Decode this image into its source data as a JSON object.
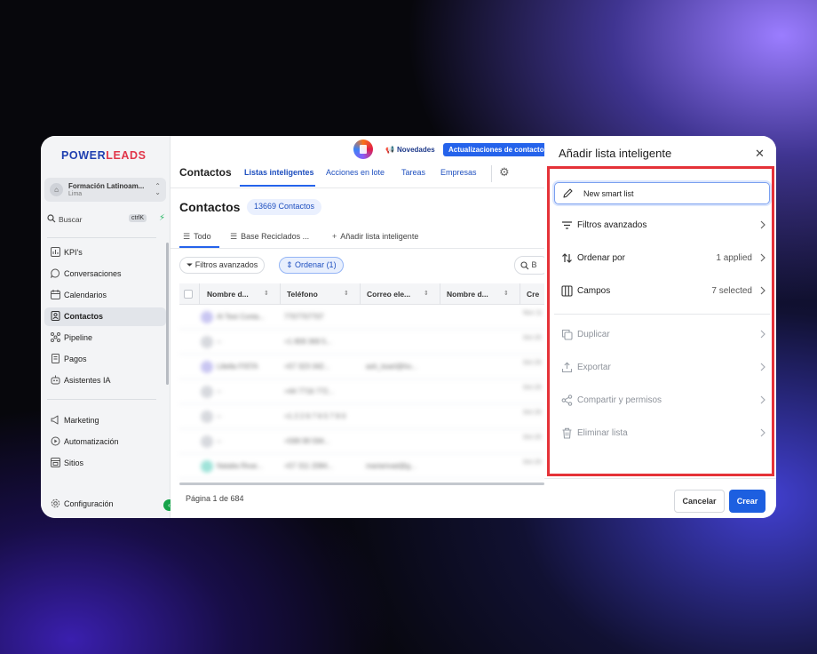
{
  "sidebar": {
    "logo": "POWERLEADS",
    "account": {
      "name": "Formación Latinoam...",
      "location": "Lima"
    },
    "search": {
      "label": "Buscar",
      "shortcut": "ctrlK"
    },
    "items": [
      {
        "label": "KPI's",
        "icon": "chart-icon"
      },
      {
        "label": "Conversaciones",
        "icon": "chat-icon"
      },
      {
        "label": "Calendarios",
        "icon": "calendar-icon"
      },
      {
        "label": "Contactos",
        "icon": "contacts-icon",
        "active": true
      },
      {
        "label": "Pipeline",
        "icon": "pipeline-icon"
      },
      {
        "label": "Pagos",
        "icon": "payments-icon"
      },
      {
        "label": "Asistentes IA",
        "icon": "robot-icon"
      },
      {
        "label": "Marketing",
        "icon": "megaphone-icon"
      },
      {
        "label": "Automatización",
        "icon": "automation-icon"
      },
      {
        "label": "Sitios",
        "icon": "globe-icon"
      }
    ],
    "settings": "Configuración"
  },
  "topbar": {
    "news_label": "Novedades",
    "updates_label": "Actualizaciones de contacto"
  },
  "tabs": [
    {
      "label": "Contactos"
    },
    {
      "label": "Listas inteligentes",
      "selected": true
    },
    {
      "label": "Acciones en lote"
    },
    {
      "label": "Tareas"
    },
    {
      "label": "Empresas"
    }
  ],
  "main": {
    "title": "Contactos",
    "count_badge": "13669 Contactos",
    "list_tabs": [
      {
        "label": "Todo",
        "selected": true
      },
      {
        "label": "Base Reciclados ..."
      },
      {
        "label": "Añadir lista inteligente"
      }
    ],
    "filter_button": "Filtros avanzados",
    "order_button": "Ordenar (1)",
    "search_placeholder": "B",
    "columns": [
      "Nombre d...",
      "Teléfono",
      "Correo ele...",
      "Nombre d...",
      "Cre"
    ],
    "rows": [
      {
        "name": "Al Test Conta...",
        "phone": "7707707707",
        "email": "",
        "date": "Nov 11"
      },
      {
        "name": "--",
        "phone": "+1 809 369 5...",
        "email": "",
        "date": "Oct 20"
      },
      {
        "name": "Liliella FISTA",
        "phone": "+57 323 342...",
        "email": "ash_ksarl@ho...",
        "date": "Oct 20"
      },
      {
        "name": "--",
        "phone": "+44 7716 772...",
        "email": "",
        "date": "Oct 20"
      },
      {
        "name": "--",
        "phone": "+1 2 2 6 7 6 5 7 9 0",
        "email": "",
        "date": "Oct 20"
      },
      {
        "name": "--",
        "phone": "+599 99 594...",
        "email": "",
        "date": "Oct 20"
      },
      {
        "name": "Natalia Rivar...",
        "phone": "+57 311 2084...",
        "email": "mariarivad@g...",
        "date": "Oct 20"
      }
    ],
    "pagination": "Página 1 de 684"
  },
  "panel": {
    "title": "Añadir lista inteligente",
    "name_input": {
      "value": "New smart list",
      "placeholder": ""
    },
    "options": [
      {
        "label": "Filtros avanzados",
        "value": "",
        "icon": "filter-lines-icon",
        "enabled": true
      },
      {
        "label": "Ordenar por",
        "value": "1 applied",
        "icon": "sort-arrows-icon",
        "enabled": true
      },
      {
        "label": "Campos",
        "value": "7 selected",
        "icon": "columns-icon",
        "enabled": true
      }
    ],
    "actions": [
      {
        "label": "Duplicar",
        "icon": "duplicate-icon",
        "enabled": false
      },
      {
        "label": "Exportar",
        "icon": "export-icon",
        "enabled": false
      },
      {
        "label": "Compartir y permisos",
        "icon": "share-icon",
        "enabled": false
      },
      {
        "label": "Eliminar lista",
        "icon": "trash-icon",
        "enabled": false
      }
    ],
    "cancel_label": "Cancelar",
    "create_label": "Crear"
  },
  "colors": {
    "accent": "#1d5fe0",
    "highlight_border": "#e53238",
    "brand_blue": "#1f3fb0",
    "brand_red": "#e1364a"
  }
}
